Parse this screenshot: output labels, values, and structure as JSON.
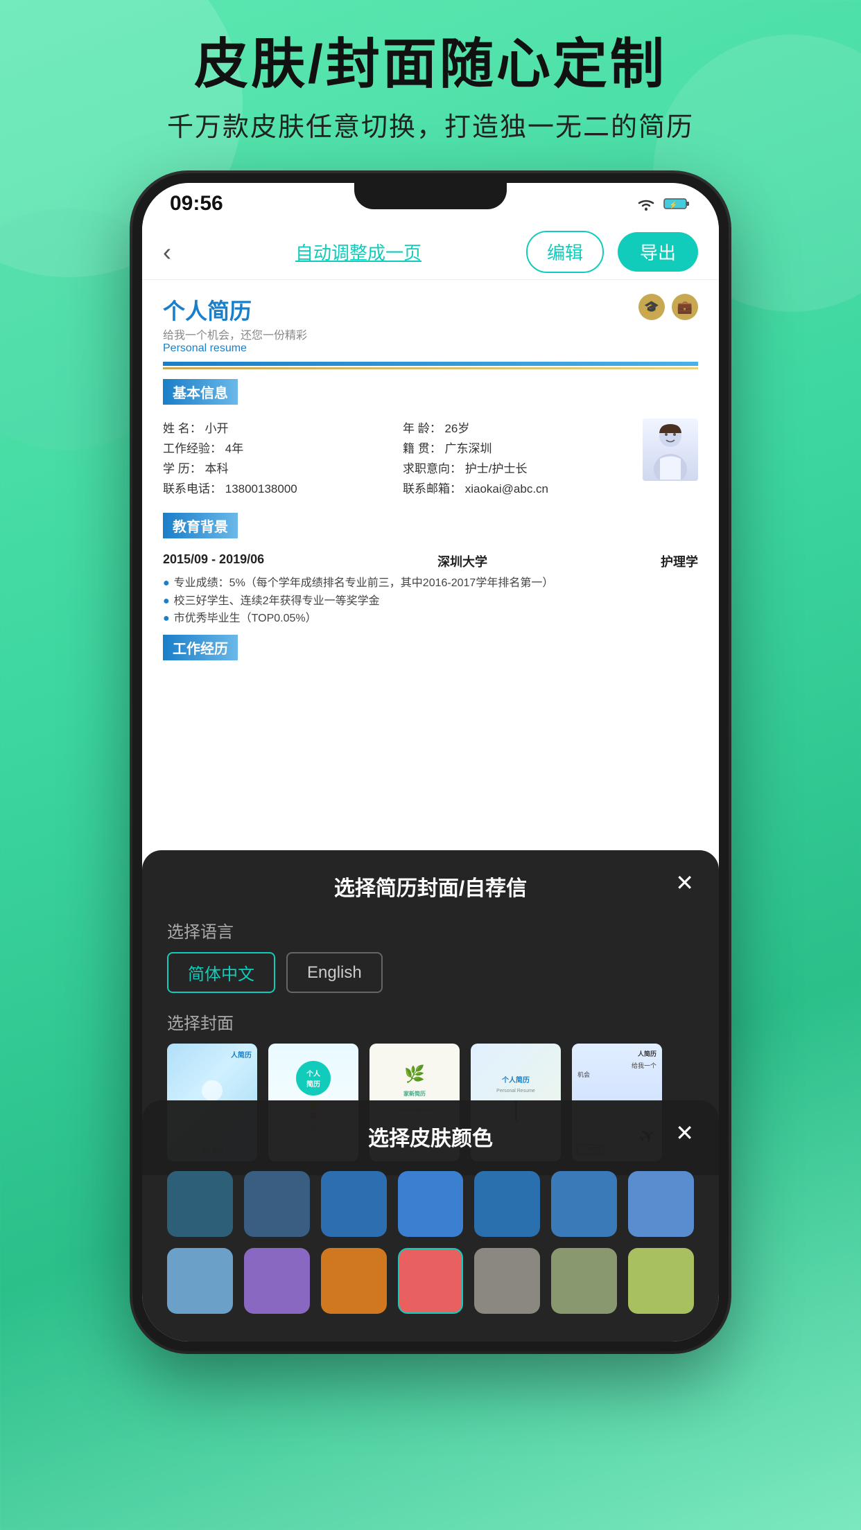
{
  "background": {
    "gradient_start": "#5ce8b0",
    "gradient_end": "#2bbf8a"
  },
  "header": {
    "title": "皮肤/封面随心定制",
    "subtitle": "千万款皮肤任意切换，打造独一无二的简历"
  },
  "phone": {
    "status_bar": {
      "time": "09:56",
      "wifi": true,
      "battery": true
    },
    "nav": {
      "auto_adjust": "自动调整成一页",
      "edit_btn": "编辑",
      "export_btn": "导出"
    },
    "resume": {
      "title": "个人简历",
      "subtitle": "给我一个机会，还您一份精彩",
      "subtitle_en": "Personal resume",
      "section_basic": "基本信息",
      "fields": {
        "name_label": "姓   名：",
        "name_value": "小开",
        "age_label": "年   龄：",
        "age_value": "26岁",
        "exp_label": "工作经验：",
        "exp_value": "4年",
        "hometown_label": "籍   贯：",
        "hometown_value": "广东深圳",
        "edu_label": "学   历：",
        "edu_value": "本科",
        "intent_label": "求职意向：",
        "intent_value": "护士/护士长",
        "phone_label": "联系电话：",
        "phone_value": "13800138000",
        "email_label": "联系邮箱：",
        "email_value": "xiaokai@abc.cn"
      },
      "section_education": "教育背景",
      "edu_period": "2015/09 - 2019/06",
      "edu_school": "深圳大学",
      "edu_major": "护理学",
      "edu_bullets": [
        "专业成绩：5%（每个学年成绩排名专业前三，其中2016-2017学年排名第一）",
        "校三好学生、连续2年获得专业一等奖学金",
        "市优秀毕业生（TOP0.05%）"
      ],
      "section_work": "工作经历"
    }
  },
  "modal_cover": {
    "title": "选择简历封面/自荐信",
    "lang_label": "选择语言",
    "lang_cn": "简体中文",
    "lang_en": "English",
    "cover_label": "选择封面",
    "covers": [
      {
        "id": 1,
        "style": "watercolor_blue",
        "text": "人简历"
      },
      {
        "id": 2,
        "style": "balloon_cyan",
        "text": "个人\n简历"
      },
      {
        "id": 3,
        "style": "leaf_green",
        "text": "家新简历"
      },
      {
        "id": 4,
        "style": "clean_cn",
        "text": "个人简历"
      },
      {
        "id": 5,
        "style": "paper_plane",
        "text": "人简历"
      }
    ]
  },
  "modal_skin": {
    "title": "选择皮肤颜色",
    "colors_row1": [
      "#2e5f78",
      "#3a5e82",
      "#2d6eb0",
      "#3a7fd0",
      "#2a6fae",
      "#3a7ab8",
      "#5a8cd0"
    ],
    "colors_row2": [
      "#6ba0c8",
      "#8868c0",
      "#d07820",
      "#e86060",
      "#8a8880",
      "#8a9870",
      "#a8c060",
      "#90b880"
    ]
  }
}
